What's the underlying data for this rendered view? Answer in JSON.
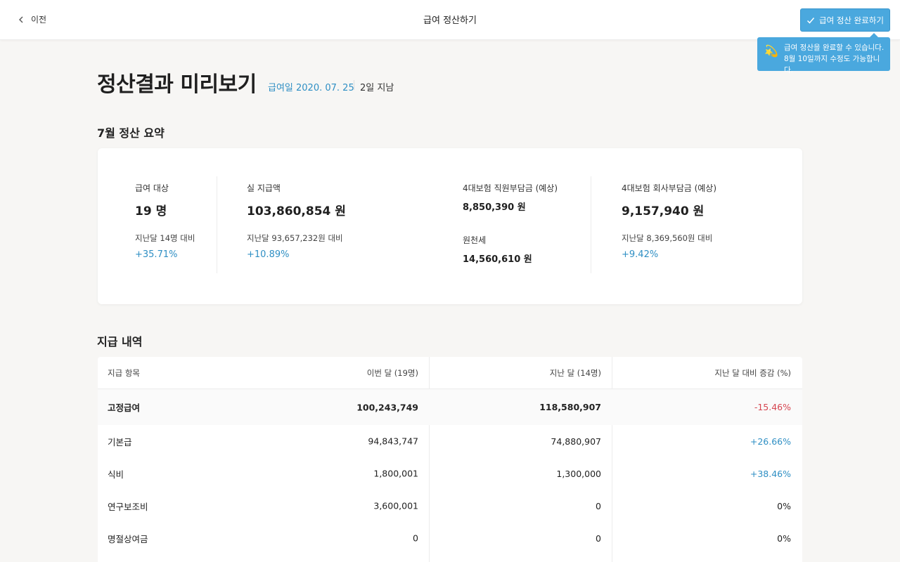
{
  "header": {
    "back_label": "이전",
    "title": "급여 정산하기",
    "complete_button": "급여 정산 완료하기"
  },
  "tooltip": {
    "line1": "급여 정산을 완료할 수 있습니다.",
    "line2": "8월 10일까지 수정도 가능합니다."
  },
  "page": {
    "title": "정산결과 미리보기",
    "payday": "급여일 2020. 07. 25",
    "elapsed": "2일 지남"
  },
  "summary": {
    "section_title": "7월 정산 요약",
    "headcount": {
      "label": "급여 대상",
      "value": "19 명",
      "compare": "지난달 14명 대비",
      "change": "+35.71%"
    },
    "net_pay": {
      "label": "실 지급액",
      "value": "103,860,854 원",
      "compare": "지난달 93,657,232원 대비",
      "change": "+10.89%"
    },
    "employee_insurance": {
      "label": "4대보험 직원부담금 (예상)",
      "value": "8,850,390 원"
    },
    "withholding_tax": {
      "label": "원천세",
      "value": "14,560,610 원"
    },
    "company_insurance": {
      "label": "4대보험 회사부담금 (예상)",
      "value": "9,157,940 원",
      "compare": "지난달 8,369,560원 대비",
      "change": "+9.42%"
    }
  },
  "payments": {
    "section_title": "지급 내역",
    "columns": [
      "지급 항목",
      "이번 달 (19명)",
      "지난 달 (14명)",
      "지난 달 대비 증감 (%)"
    ],
    "rows": [
      {
        "item": "고정급여",
        "this_month": "100,243,749",
        "last_month": "118,580,907",
        "change": "-15.46%"
      },
      {
        "item": "기본급",
        "this_month": "94,843,747",
        "last_month": "74,880,907",
        "change": "+26.66%"
      },
      {
        "item": "식비",
        "this_month": "1,800,001",
        "last_month": "1,300,000",
        "change": "+38.46%"
      },
      {
        "item": "연구보조비",
        "this_month": "3,600,001",
        "last_month": "0",
        "change": "0%"
      },
      {
        "item": "명절상여금",
        "this_month": "0",
        "last_month": "0",
        "change": "0%"
      }
    ]
  },
  "colors": {
    "accent": "#4aa8de",
    "positive": "#2f8fc4",
    "negative": "#d64550"
  }
}
